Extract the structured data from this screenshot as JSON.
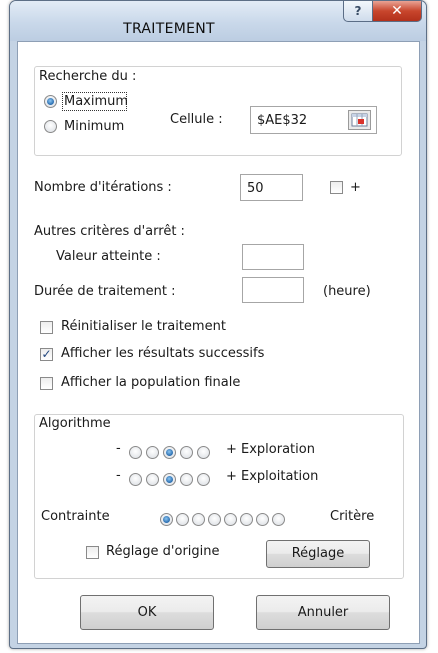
{
  "window": {
    "title": "TRAITEMENT"
  },
  "titlebar": {
    "help_label": "?",
    "close_label": "✕"
  },
  "search": {
    "legend": "Recherche du :",
    "options": [
      {
        "label": "Maximum",
        "selected": true
      },
      {
        "label": "Minimum",
        "selected": false
      }
    ],
    "cell_label": "Cellule :",
    "cell_value": "$AE$32"
  },
  "iterations": {
    "label": "Nombre d'itérations :",
    "value": "50",
    "plus_label": "+",
    "plus_checked": false
  },
  "stop_criteria": {
    "heading": "Autres critères d'arrêt :",
    "value_label": "Valeur atteinte :",
    "value": "",
    "duration_label": "Durée de traitement :",
    "duration": "",
    "unit": "(heure)"
  },
  "options": [
    {
      "label": "Réinitialiser le traitement",
      "checked": false
    },
    {
      "label": "Afficher les résultats successifs",
      "checked": true
    },
    {
      "label": "Afficher la population finale",
      "checked": false
    }
  ],
  "algorithm": {
    "legend": "Algorithme",
    "exploration": {
      "minus": "-",
      "label": "+ Exploration",
      "count": 5,
      "selected": 3
    },
    "exploitation": {
      "minus": "-",
      "label": "+ Exploitation",
      "count": 5,
      "selected": 3
    },
    "constraint": {
      "left_label": "Contrainte",
      "right_label": "Critère",
      "count": 8,
      "selected": 1
    },
    "default_label": "Réglage d'origine",
    "default_checked": false,
    "settings_button": "Réglage"
  },
  "buttons": {
    "ok": "OK",
    "cancel": "Annuler"
  },
  "colors": {
    "frame": "#c4d3e4",
    "close_button": "#c8462d",
    "checkmark": "#21467e",
    "radio_selected": "#1f63a8"
  },
  "icons": {
    "cell_ref": "range-select-icon",
    "close": "close-icon",
    "help": "help-icon"
  }
}
